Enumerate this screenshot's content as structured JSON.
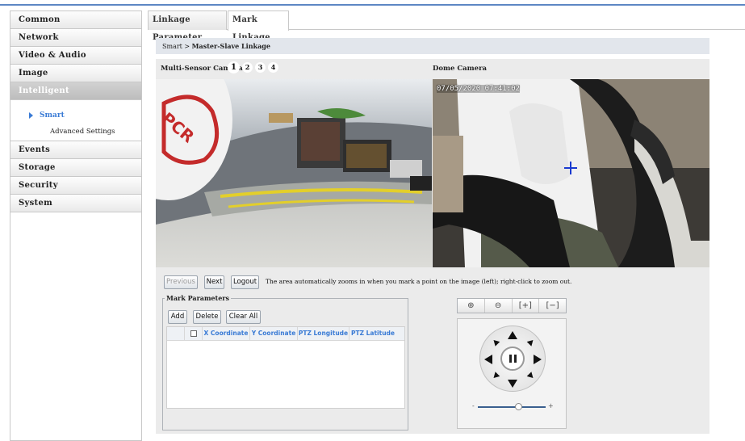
{
  "sidebar": {
    "items": [
      {
        "label": "Common"
      },
      {
        "label": "Network"
      },
      {
        "label": "Video & Audio"
      },
      {
        "label": "Image"
      },
      {
        "label": "Intelligent"
      },
      {
        "label": "Events"
      },
      {
        "label": "Storage"
      },
      {
        "label": "Security"
      },
      {
        "label": "System"
      }
    ],
    "submenu": {
      "active": "Smart",
      "other": "Advanced Settings"
    }
  },
  "tabs": [
    {
      "label": "Linkage Parameter"
    },
    {
      "label": "Mark Linkage"
    }
  ],
  "breadcrumb": {
    "root": "Smart",
    "separator": ">",
    "current": "Master-Slave Linkage"
  },
  "cameras": {
    "multi_label": "Multi-Sensor Camera",
    "dome_label": "Dome Camera",
    "pages": [
      "1",
      "2",
      "3",
      "4"
    ],
    "timestamp": "07/05/2020 07:41:02"
  },
  "controls": {
    "previous": "Previous",
    "next": "Next",
    "logout": "Logout",
    "hint": "The area automatically zooms in when you mark a point on the image (left); right-click to zoom out."
  },
  "mark_parameters": {
    "legend": "Mark Parameters",
    "add": "Add",
    "delete": "Delete",
    "clear_all": "Clear All",
    "columns": [
      "X Coordinate",
      "Y Coordinate",
      "PTZ Longitude",
      "PTZ Latitude"
    ]
  },
  "ptz": {
    "zoom_in": "⊕",
    "zoom_out": "⊖",
    "fit_in": "[+]",
    "fit_out": "[−]",
    "slider_min": "-",
    "slider_max": "+",
    "speed": 0.6
  },
  "colors": {
    "accent": "#3a7bd5",
    "topline": "#5d87c4"
  }
}
